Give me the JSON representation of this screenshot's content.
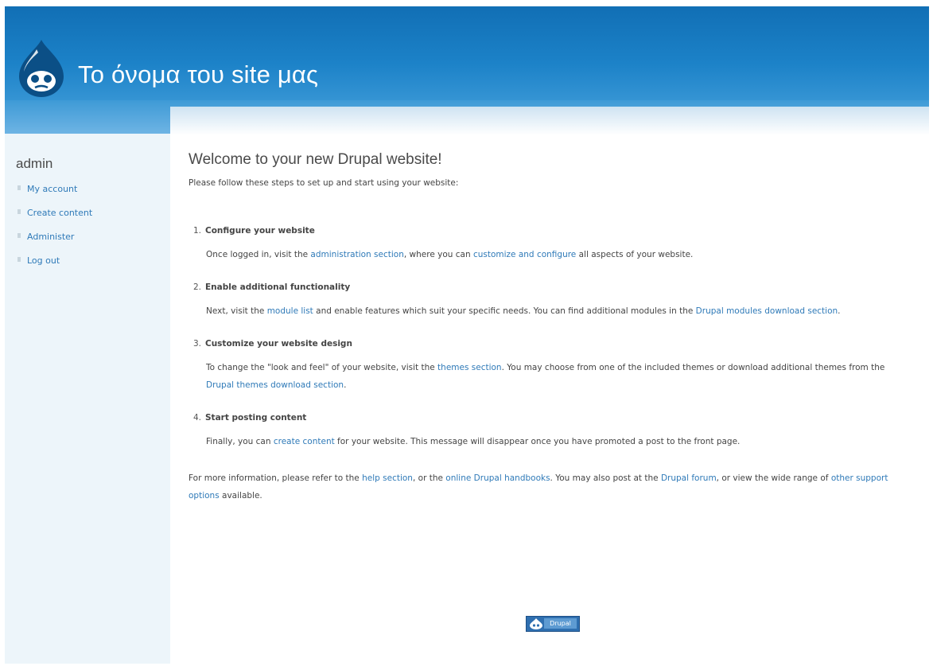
{
  "header": {
    "site_name": "Το όνομα του site μας",
    "logo_icon": "drupal-drop-icon",
    "colors": {
      "header_blue": "#1c82c8",
      "link": "#2f7ab8"
    }
  },
  "sidebar": {
    "user_name": "admin",
    "items": [
      {
        "label": "My account"
      },
      {
        "label": "Create content"
      },
      {
        "label": "Administer"
      },
      {
        "label": "Log out"
      }
    ]
  },
  "main": {
    "title": "Welcome to your new Drupal website!",
    "intro": "Please follow these steps to set up and start using your website:",
    "steps": [
      {
        "number": "1.",
        "title": "Configure your website",
        "t1": "Once logged in, visit the ",
        "l1": "administration section",
        "t2": ", where you can ",
        "l2": "customize and configure",
        "t3": " all aspects of your website."
      },
      {
        "number": "2.",
        "title": "Enable additional functionality",
        "t1": "Next, visit the ",
        "l1": "module list",
        "t2": " and enable features which suit your specific needs. You can find additional modules in the ",
        "l2": "Drupal modules download section",
        "t3": "."
      },
      {
        "number": "3.",
        "title": "Customize your website design",
        "t1": "To change the \"look and feel\" of your website, visit the ",
        "l1": "themes section",
        "t2": ". You may choose from one of the included themes or download additional themes from the ",
        "l2": "Drupal themes download section",
        "t3": "."
      },
      {
        "number": "4.",
        "title": "Start posting content",
        "t1": "Finally, you can ",
        "l1": "create content",
        "t2": " for your website. This message will disappear once you have promoted a post to the front page."
      }
    ],
    "more": {
      "t1": "For more information, please refer to the ",
      "l1": "help section",
      "t2": ", or the ",
      "l2": "online Drupal handbooks",
      "t3": ". You may also post at the ",
      "l3": "Drupal forum",
      "t4": ", or view the wide range of ",
      "l4": "other support options",
      "t5": " available."
    }
  },
  "footer": {
    "badge_label": "Drupal",
    "badge_icon": "drupal-drop-icon"
  }
}
